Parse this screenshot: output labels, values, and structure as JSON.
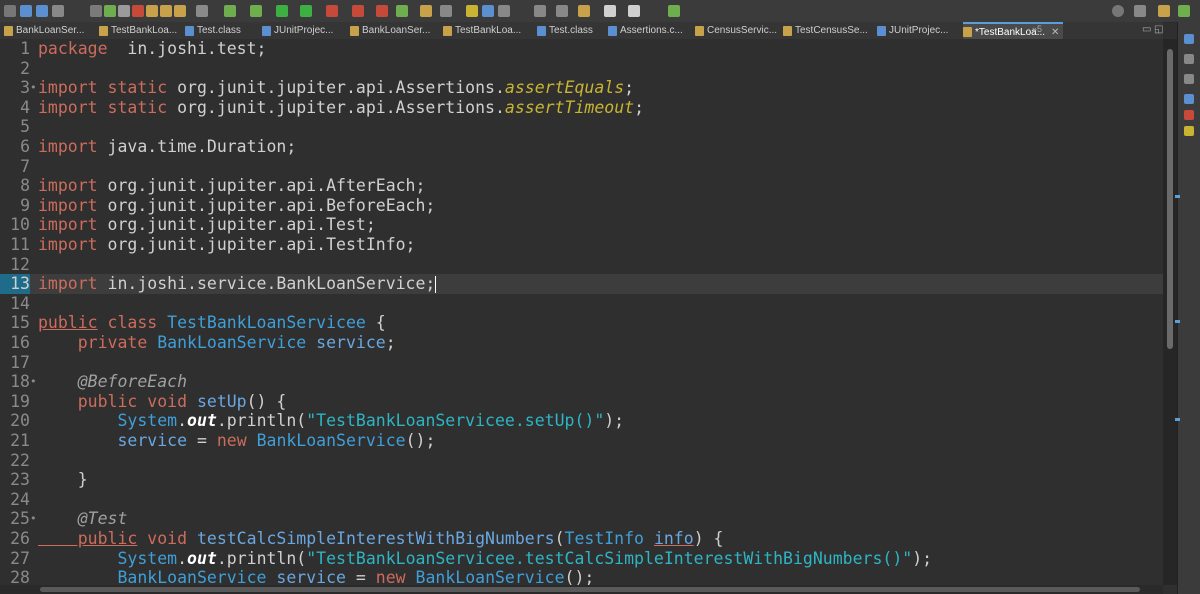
{
  "tabs": [
    {
      "label": "BankLoanSer...",
      "kind": "java"
    },
    {
      "label": "TestBankLoa...",
      "kind": "java"
    },
    {
      "label": "Test.class",
      "kind": "class"
    },
    {
      "label": "JUnitProjec...",
      "kind": "class"
    },
    {
      "label": "BankLoanSer...",
      "kind": "java"
    },
    {
      "label": "TestBankLoa...",
      "kind": "java"
    },
    {
      "label": "Test.class",
      "kind": "class"
    },
    {
      "label": "Assertions.c...",
      "kind": "class"
    },
    {
      "label": "CensusServic...",
      "kind": "java"
    },
    {
      "label": "TestCensusSe...",
      "kind": "java"
    },
    {
      "label": "JUnitProjec...",
      "kind": "class"
    },
    {
      "label": "*TestBankLoa...",
      "kind": "java",
      "active": true
    }
  ],
  "overflow_label": "»5",
  "code_lines": [
    {
      "n": "1",
      "segs": [
        [
          "kw",
          "package"
        ],
        [
          "",
          "  in.joshi.test;"
        ]
      ]
    },
    {
      "n": "2",
      "segs": []
    },
    {
      "n": "3",
      "fold": "•",
      "segs": [
        [
          "kw",
          "import"
        ],
        [
          "kw",
          " static"
        ],
        [
          "",
          ""
        ],
        [
          "",
          " org.junit.jupiter.api.Assertions."
        ],
        [
          "ita",
          "assertEquals"
        ],
        [
          "",
          ";"
        ]
      ]
    },
    {
      "n": "4",
      "segs": [
        [
          "kw",
          "import"
        ],
        [
          "kw",
          " static"
        ],
        [
          "",
          " org.junit.jupiter.api.Assertions."
        ],
        [
          "ita",
          "assertTimeout"
        ],
        [
          "",
          ";"
        ]
      ]
    },
    {
      "n": "5",
      "segs": []
    },
    {
      "n": "6",
      "segs": [
        [
          "kw",
          "import"
        ],
        [
          "",
          " java.time.Duration;"
        ]
      ]
    },
    {
      "n": "7",
      "segs": []
    },
    {
      "n": "8",
      "segs": [
        [
          "kw",
          "import"
        ],
        [
          "",
          " org.junit.jupiter.api.AfterEach;"
        ]
      ]
    },
    {
      "n": "9",
      "segs": [
        [
          "kw",
          "import"
        ],
        [
          "",
          " org.junit.jupiter.api.BeforeEach;"
        ]
      ]
    },
    {
      "n": "10",
      "segs": [
        [
          "kw",
          "import"
        ],
        [
          "",
          " org.junit.jupiter.api.Test;"
        ]
      ]
    },
    {
      "n": "11",
      "segs": [
        [
          "kw",
          "import"
        ],
        [
          "",
          " org.junit.jupiter.api.TestInfo;"
        ]
      ]
    },
    {
      "n": "12",
      "segs": []
    },
    {
      "n": "13",
      "current": true,
      "segs": [
        [
          "kw",
          "import"
        ],
        [
          "",
          " in.joshi.service.BankLoanService;"
        ]
      ]
    },
    {
      "n": "14",
      "segs": []
    },
    {
      "n": "15",
      "segs": [
        [
          "kw under",
          "public"
        ],
        [
          "kw",
          " class"
        ],
        [
          "typ",
          " TestBankLoanServicee"
        ],
        [
          "",
          " {"
        ]
      ]
    },
    {
      "n": "16",
      "segs": [
        [
          "kw",
          "    private"
        ],
        [
          "typ",
          " BankLoanService"
        ],
        [
          "fld",
          " service"
        ],
        [
          "",
          ";"
        ]
      ]
    },
    {
      "n": "17",
      "segs": []
    },
    {
      "n": "18",
      "fold": "•",
      "segs": [
        [
          "ann",
          "    @BeforeEach"
        ]
      ]
    },
    {
      "n": "19",
      "segs": [
        [
          "kw",
          "    public"
        ],
        [
          "kw",
          " void"
        ],
        [
          "fld",
          " setUp"
        ],
        [
          "",
          "() {"
        ]
      ]
    },
    {
      "n": "20",
      "segs": [
        [
          "typ",
          "        System"
        ],
        [
          "",
          "."
        ],
        [
          "stat",
          "out"
        ],
        [
          "",
          ".println("
        ],
        [
          "str",
          "\"TestBankLoanServicee.setUp()\""
        ],
        [
          "",
          ");"
        ]
      ]
    },
    {
      "n": "21",
      "segs": [
        [
          "fld",
          "        service"
        ],
        [
          "",
          " = "
        ],
        [
          "kw",
          "new"
        ],
        [
          "typ",
          " BankLoanService"
        ],
        [
          "",
          "();"
        ]
      ]
    },
    {
      "n": "22",
      "segs": []
    },
    {
      "n": "23",
      "segs": [
        [
          "",
          "    }"
        ]
      ]
    },
    {
      "n": "24",
      "segs": []
    },
    {
      "n": "25",
      "fold": "•",
      "segs": [
        [
          "ann",
          "    @Test"
        ]
      ]
    },
    {
      "n": "26",
      "segs": [
        [
          "kw under",
          "    public"
        ],
        [
          "kw",
          " void"
        ],
        [
          "fld",
          " testCalcSimpleInterestWithBigNumbers"
        ],
        [
          "",
          "("
        ],
        [
          "typ",
          "TestInfo"
        ],
        [
          "",
          " "
        ],
        [
          "fld under",
          "info"
        ],
        [
          "",
          ") {"
        ]
      ]
    },
    {
      "n": "27",
      "segs": [
        [
          "typ",
          "        System"
        ],
        [
          "",
          "."
        ],
        [
          "stat",
          "out"
        ],
        [
          "",
          ".println("
        ],
        [
          "str",
          "\"TestBankLoanServicee.testCalcSimpleInterestWithBigNumbers()\""
        ],
        [
          "",
          ");"
        ]
      ]
    },
    {
      "n": "28",
      "segs": [
        [
          "typ",
          "        BankLoanService"
        ],
        [
          "fld",
          " service"
        ],
        [
          "",
          " = "
        ],
        [
          "kw",
          "new"
        ],
        [
          "typ",
          " BankLoanService"
        ],
        [
          "",
          "();"
        ]
      ]
    }
  ]
}
